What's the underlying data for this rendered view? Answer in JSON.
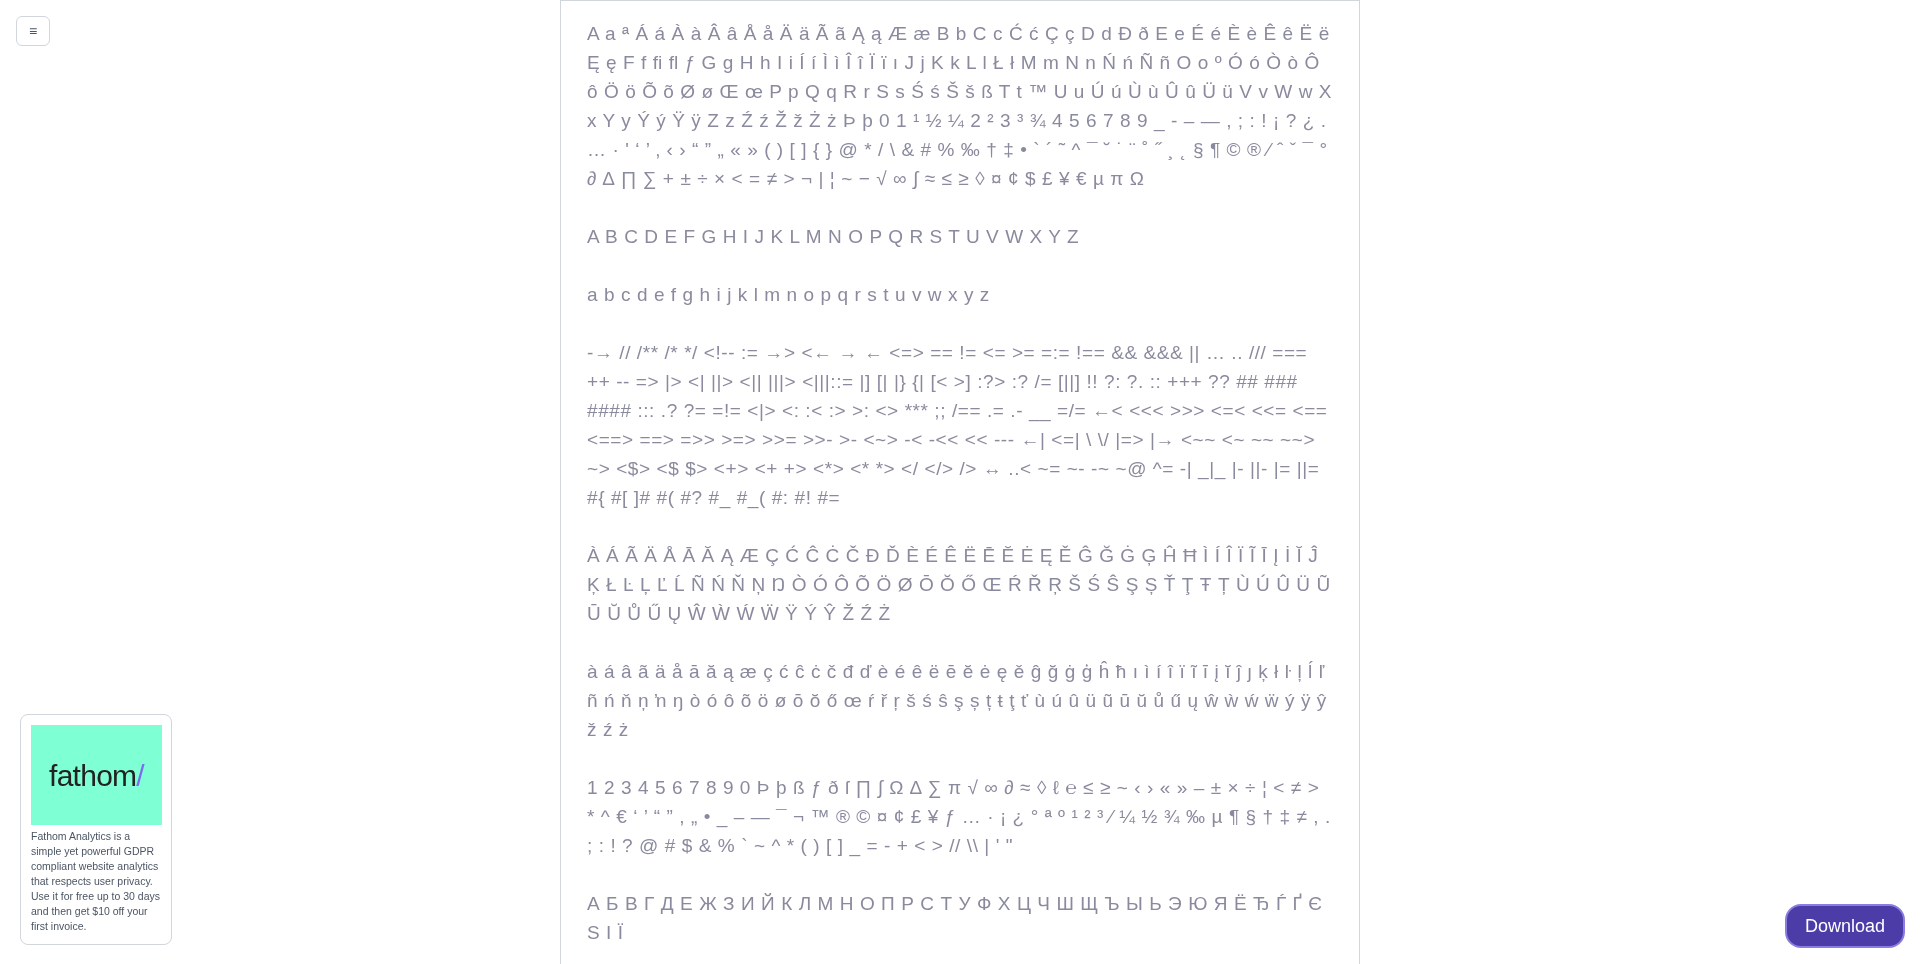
{
  "menu_button": {
    "label": "≡"
  },
  "specimen": {
    "paragraphs": [
      "A a ª Á á À à Â â Å å Ä ä Ã ã Ą ą Æ æ B b C c Ć ć Ç ç D d Đ ð E e É é È è Ê ê Ë ë Ę ę F f ﬁ ﬂ ƒ G g H h I i Í í Ì ì Î î Ï ï ı J j K k L l Ł ł M m N n Ń ń Ñ ñ O o º Ó ó Ò ò Ô ô Ö ö Õ õ Ø ø Œ œ P p Q q R r S s Ś ś Š š ß T t ™ U u Ú ú Ù ù Û û Ü ü V v W w X x Y y Ý ý Ÿ ÿ Z z Ź ź Ž ž Ż ż Þ þ 0 1 ¹ ½ ¼ 2 ² 3 ³ ¾ 4 5 6 7 8 9 _ - – — , ; : ! ¡ ? ¿ . … · ' ‘ ’ ‚ ‹ › “ ” „ « » ( ) [ ] { } @ * / \\ & # % ‰ † ‡ • ` ´ ˜ ^ ¯ ˘ ˙ ¨ ˚ ˝ ¸ ˛ § ¶ © ® ⁄ ˆ ˇ ¯ ° ∂ ∆ ∏ ∑ + ± ÷ × < = ≠ > ¬ | ¦ ~ − √ ∞ ∫ ≈ ≤ ≥ ◊ ¤ ¢ $ £ ¥ € µ π Ω",
      "A B C D E F G H I J K L M N O P Q R S T U V W X Y Z",
      "a b c d e f g h i j k l m n o p q r s t u v w x y z",
      "-→ // /** /* */ <!-- := →> <← → ← <=> == != <= >= =:= !== && &&& || … .. /// === ++ -- => |> <| ||> <|| |||> <|||::= |] [| |} {| [< >] :?> :? /= [||] !! ?: ?. :: +++ ?? ## ### #### ::: .? ?= =!= <|> <: :< :> >: <> *** ;; /== .= .- __ =/= ←< <<< >>> <=< <<= <== <==> ==> =>> >=> >>= >>- >- <~> -< -<< << --- ←| <=| \\ \\/ |=> |→ <~~ <~ ~~ ~~> ~> <$> <$ $> <+> <+ +> <*> <* *> </ </> /> ↔ ..< ~= ~- -~ ~@ ^= -| _|_ |- ||- |= ||= #{ #[ ]# #( #? #_ #_( #: #! #=",
      "À Á Ã Ä Å Ā Ă Ą Æ Ç Ć Ĉ Ċ Č Đ Ď È É Ê Ë Ē Ĕ Ė Ę Ě Ĝ Ğ Ġ Ģ Ĥ Ħ Ì Í Î Ï Ĩ Ī Į İ Ĭ Ĵ Ķ Ł Ŀ Ļ Ľ Ĺ Ñ Ń Ň Ņ Ŋ Ò Ó Ô Õ Ö Ø Ō Ŏ Ő Œ Ŕ Ř Ŗ Š Ś Ŝ Ş Ș Ť Ţ Ŧ Ț Ù Ú Û Ü Ũ Ū Ŭ Ů Ű Ų Ŵ Ẁ Ẃ Ẅ Ÿ Ý Ŷ Ž Ź Ż",
      "à á â ã ä å ā ă ą æ ç ć ĉ ċ č đ ď è é ê ë ē ĕ ė ę ě ĝ ğ ġ ģ ĥ ħ ı ì í î ï ĩ ī į ĭ ĵ ȷ ķ ł ŀ ļ ĺ ľ ñ ń ň ņ ŉ ŋ ò ó ô õ ö ø ō ŏ ő œ ŕ ř ŗ š ś ŝ ş ș ț ŧ ţ ť ù ú û ü ũ ū ŭ ů ű ų ŵ ẁ ẃ ẅ ý ÿ ŷ ž ź ż",
      "1 2 3 4 5 6 7 8 9 0 Þ þ ß ƒ ð ſ ∏ ∫ Ω ∆ ∑ π √ ∞ ∂ ≈ ◊ ℓ ℮ ≤ ≥ ~ ‹ › « » – ± × ÷ ¦ < ≠ > * ^ € ‘ ’ “ ” , „ • _ – — ¯ ¬ ™ ® © ¤ ¢ £ ¥ ƒ … · ¡ ¿ ° ª º ¹ ² ³ ⁄ ¼ ½ ¾ ‰ µ ¶ § † ‡ ≠ , . ; : ! ? @ # $ & % ` ~ ^ * ( ) [ ] _ = - + < > // \\\\ | ' \"",
      "А Б В Г Д Е Ж З И Й К Л М Н О П Р С Т У Ф Х Ц Ч Ш Щ Ъ Ы Ь Э Ю Я Ё Ђ Ѓ Ґ Є Ѕ І Ї"
    ]
  },
  "ad": {
    "wordmark": "fathom",
    "wordmark_mark": "/",
    "description": "Fathom Analytics is a simple yet powerful GDPR compliant website analytics that respects user privacy. Use it for free up to 30 days and then get $10 off your first invoice."
  },
  "download_button": {
    "label": "Download"
  }
}
